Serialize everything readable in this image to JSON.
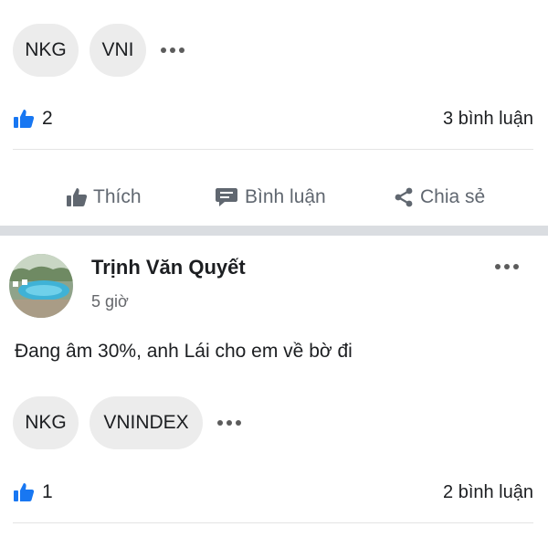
{
  "post1": {
    "tags": [
      "NKG",
      "VNI"
    ],
    "likes": "2",
    "comments": "3 bình luận"
  },
  "actions": {
    "like": "Thích",
    "comment": "Bình luận",
    "share": "Chia sẻ"
  },
  "post2": {
    "author": "Trịnh Văn Quyết",
    "time": "5 giờ",
    "text": "Đang âm 30%, anh Lái cho em về bờ đi",
    "tags": [
      "NKG",
      "VNINDEX"
    ],
    "likes": "1",
    "comments": "2 bình luận"
  },
  "colors": {
    "like_blue": "#1877f2",
    "tag_bg": "#ececec",
    "action_gray": "#606770",
    "separator": "#dadde1"
  },
  "icons": [
    "like-icon",
    "thumb-icon",
    "comment-icon",
    "share-icon",
    "more-dots-icon"
  ]
}
